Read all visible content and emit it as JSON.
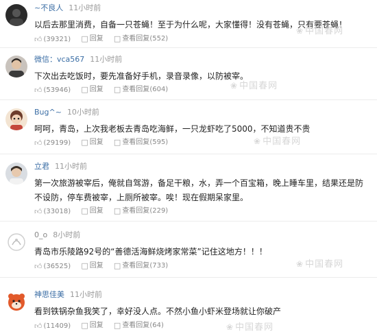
{
  "labels": {
    "reply": "回复",
    "view_replies": "查看回复"
  },
  "icons": {
    "like": "thumbs-up-icon",
    "reply": "chat-bubble-icon",
    "view": "comment-list-icon"
  },
  "watermark": "中国春网",
  "comments": [
    {
      "user": "~不良人",
      "time": "11小时前",
      "text": "以后去那里消费，自备一只苍蝇！至于为什么呢，大家懂得！没有苍蝇，只有要苍蝇！",
      "likes": "(39321)",
      "replies": "(552)"
    },
    {
      "user": "微信：vca567",
      "time": "11小时前",
      "text": "下次出去吃饭时，要先准备好手机，录音录像，以防被宰。",
      "likes": "(53946)",
      "replies": "(604)"
    },
    {
      "user": "Bug^~",
      "time": "10小时前",
      "text": "呵呵，青岛，上次我老板去青岛吃海鲜，一只龙虾吃了5000，不知道贵不贵",
      "likes": "(29199)",
      "replies": "(595)"
    },
    {
      "user": "立君",
      "time": "11小时前",
      "text": "第一次旅游被宰后，俺就自驾游，备足干粮，水，弄一个百宝箱，晚上睡车里，结果还是防不设防，停车费被宰，上厕所被宰。唉！现在假期呆家里。",
      "likes": "(33018)",
      "replies": "(229)"
    },
    {
      "user": "0_o",
      "time": "8小时前",
      "text": "青岛市乐陵路92号的“善德活海鲜烧烤家常菜”记住这地方！！！",
      "likes": "(36525)",
      "replies": "(733)"
    },
    {
      "user": "神思佳美",
      "time": "11小时前",
      "text": "看到铁锅杂鱼我笑了，幸好没人点。不然小鱼小虾米登场就让你破产",
      "likes": "(11409)",
      "replies": "(64)"
    }
  ]
}
